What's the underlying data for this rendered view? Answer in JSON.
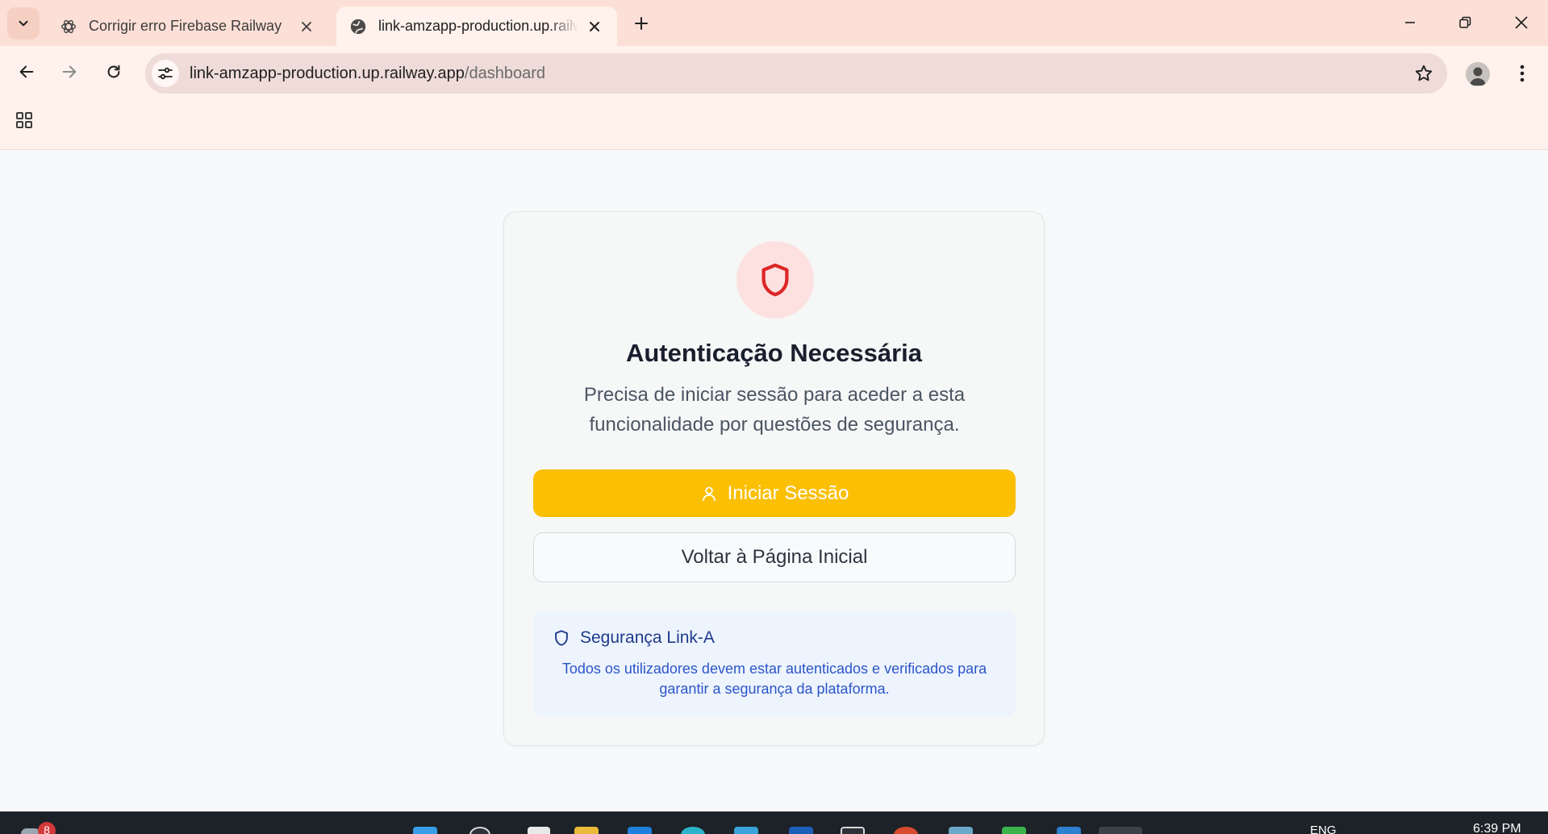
{
  "browser": {
    "tabs": [
      {
        "title": "Corrigir erro Firebase Railway",
        "active": false,
        "favicon": "openai-icon"
      },
      {
        "title": "link-amzapp-production.up.railway.app/dashboard",
        "active": true,
        "favicon": "globe-icon"
      }
    ],
    "address": {
      "host": "link-amzapp-production.up.railway.app",
      "path": "/dashboard"
    }
  },
  "auth_card": {
    "icon": "shield-icon",
    "title": "Autenticação Necessária",
    "description": "Precisa de iniciar sessão para aceder a esta funcionalidade por questões de segurança.",
    "login_button": "Iniciar Sessão",
    "home_button": "Voltar à Página Inicial",
    "security": {
      "title": "Segurança Link-A",
      "text": "Todos os utilizadores devem estar autenticados e verificados para garantir a segurança da plataforma."
    }
  },
  "taskbar": {
    "notification_count": "8",
    "language": "ENG",
    "time": "6:39 PM"
  },
  "colors": {
    "accent": "#fbbf03",
    "shield_red": "#dc2626",
    "shield_bg": "#fde0e0",
    "security_blue": "#1e3a8a"
  }
}
